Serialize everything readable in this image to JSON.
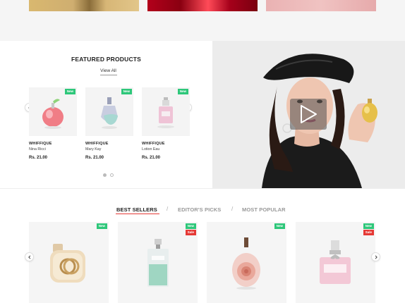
{
  "featured": {
    "title": "FEATURED PRODUCTS",
    "view_all": "View All",
    "products": [
      {
        "badge": "New",
        "brand": "WHIFFIQUE",
        "name": "Nina Ricci",
        "price": "Rs. 21.00"
      },
      {
        "badge": "New",
        "brand": "WHIFFIQUE",
        "name": "Mary Kay",
        "price": "Rs. 21.00"
      },
      {
        "badge": "New",
        "brand": "WHIFFIQUE",
        "name": "Lotion Eau",
        "price": "Rs. 21.00"
      }
    ],
    "pagination": {
      "pages": 2,
      "current": 1
    }
  },
  "tabs": {
    "best_sellers": "BEST SELLERS",
    "editors_picks": "EDITOR'S PICKS",
    "most_popular": "MOST POPULAR",
    "separator": "/"
  },
  "best_sellers": [
    {
      "badges": [
        "New"
      ]
    },
    {
      "badges": [
        "New",
        "Sale"
      ]
    },
    {
      "badges": [
        "New"
      ]
    },
    {
      "badges": [
        "New",
        "Sale"
      ]
    }
  ],
  "icons": {
    "prev": "chevron-left-icon",
    "next": "chevron-right-icon",
    "play": "play-icon"
  },
  "colors": {
    "new_badge": "#2ec77a",
    "sale_badge": "#e53935",
    "active_tab_underline": "#e53935"
  }
}
